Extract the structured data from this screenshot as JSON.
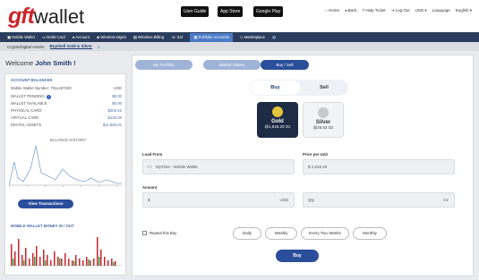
{
  "brand": {
    "name_bold": "gft",
    "name_rest": "wallet",
    "accent": "#c8262b"
  },
  "header": {
    "store_buttons": [
      "User Guide",
      "App Store",
      "Google Play"
    ],
    "links": [
      "Home",
      "Back",
      "Help Ticket",
      "Log Out",
      "USD",
      "Language",
      "English"
    ]
  },
  "nav": {
    "items": [
      "Mobile Wallet",
      "Debit Card",
      "Account",
      "Wireless Mgmt",
      "Wireless Billing",
      "ILD",
      "Portfolio Accounts",
      "Marketplace"
    ],
    "active_index": 6
  },
  "subnav": {
    "items": [
      "Crypto/Digital Assets",
      "Buy/Sell Gold & Silver"
    ],
    "active_index": 1
  },
  "welcome": {
    "prefix": "Welcome",
    "name": "John Smith !"
  },
  "balances": {
    "title": "ACCOUNT BALANCES",
    "wallet_number_label": "Mobile Wallet Number: 70xxx57200",
    "wallet_number_currency": "USD",
    "rows": [
      {
        "label": "WALLET PENDING",
        "value": "$0.00"
      },
      {
        "label": "WALLET AVAILABLE",
        "value": "$0.00"
      },
      {
        "label": "PHYSICAL CARD",
        "value": "$203.42"
      },
      {
        "label": "VIRTUAL CARD",
        "value": "$120.00"
      },
      {
        "label": "DIGITAL ASSETS",
        "value": "$11,960.81"
      }
    ]
  },
  "balance_history": {
    "title": "BALANCE HISTORY"
  },
  "view_transactions_label": "View Transactions",
  "money_in_out": {
    "title": "MOBILE WALLET MONEY IN / OUT"
  },
  "main_tabs": [
    "My Portfolio",
    "Market Values",
    "Buy / Sell"
  ],
  "buy_sell": {
    "buy": "Buy",
    "sell": "Sell"
  },
  "metals": [
    {
      "name": "Gold",
      "price": "@1,616.20 Oz",
      "selected": true
    },
    {
      "name": "Silver",
      "price": "@25.52 Oz",
      "selected": false
    }
  ],
  "load_from": {
    "label": "Load From",
    "value": "MyTime - Mobile Wallet"
  },
  "price_per_unit": {
    "label": "Price per Unit",
    "value": "$ 1,616.20"
  },
  "amount": {
    "label": "Amount",
    "value": "$",
    "currency": "USD"
  },
  "qty": {
    "placeholder": "Qty",
    "unit": "Oz"
  },
  "repeat": {
    "label": "Repeat this Buy"
  },
  "frequencies": [
    "Daily",
    "Weekly",
    "Every Two Weeks",
    "Monthly"
  ],
  "buy_button": "Buy"
}
